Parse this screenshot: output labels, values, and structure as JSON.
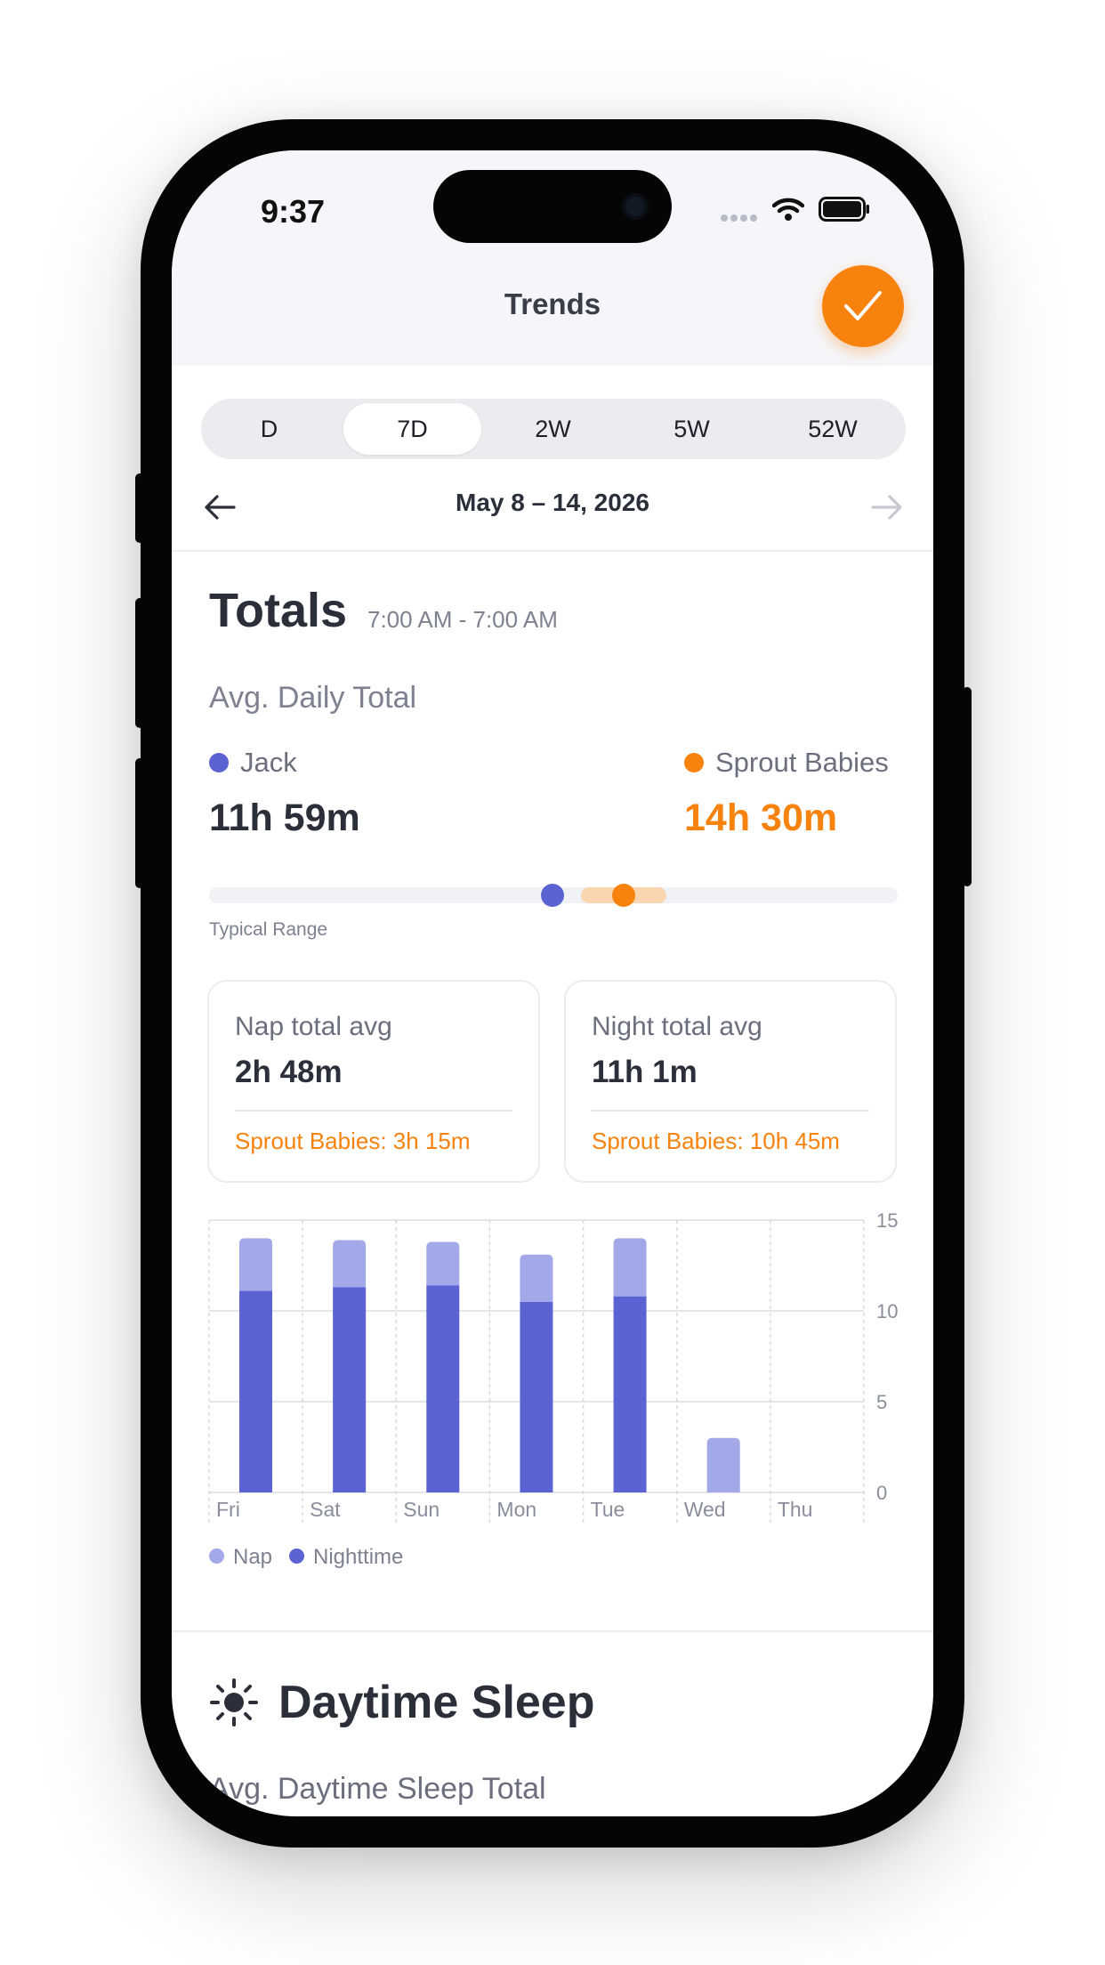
{
  "status_bar": {
    "time": "9:37"
  },
  "header": {
    "title": "Trends"
  },
  "range_selector": {
    "options": [
      "D",
      "7D",
      "2W",
      "5W",
      "52W"
    ],
    "selected": "7D"
  },
  "date_nav": {
    "range": "May 8 – 14, 2026"
  },
  "totals": {
    "heading": "Totals",
    "window": "7:00 AM - 7:00 AM",
    "avg_label": "Avg. Daily Total",
    "child": {
      "name": "Jack",
      "value": "11h 59m"
    },
    "benchmark": {
      "name": "Sprout Babies",
      "value": "14h 30m"
    },
    "typical_range_label": "Typical Range",
    "colors": {
      "child": "#5b63d3",
      "benchmark": "#f8820e",
      "nap": "#a3a8e8"
    }
  },
  "cards": [
    {
      "label": "Nap total avg",
      "value": "2h 48m",
      "comparison": "Sprout Babies: 3h 15m"
    },
    {
      "label": "Night total avg",
      "value": "11h 1m",
      "comparison": "Sprout Babies: 10h 45m"
    }
  ],
  "chart_data": {
    "type": "bar",
    "stacked": true,
    "categories": [
      "Fri",
      "Sat",
      "Sun",
      "Mon",
      "Tue",
      "Wed",
      "Thu"
    ],
    "series": [
      {
        "name": "Nighttime",
        "values": [
          11.1,
          11.3,
          11.4,
          10.5,
          10.8,
          0,
          0
        ]
      },
      {
        "name": "Nap",
        "values": [
          2.9,
          2.6,
          2.4,
          2.6,
          3.2,
          3.0,
          0
        ]
      }
    ],
    "y_ticks": [
      "0",
      "5",
      "10",
      "15"
    ],
    "ylim": [
      0,
      15
    ],
    "legend": [
      "Nap",
      "Nighttime"
    ],
    "legend_position": "bottom-left"
  },
  "daytime": {
    "heading": "Daytime Sleep",
    "sub": "Avg. Daytime Sleep Total"
  }
}
